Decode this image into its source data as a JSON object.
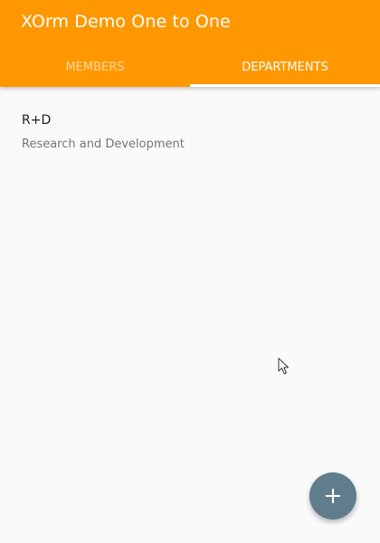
{
  "app_bar": {
    "title": "XOrm Demo One to One",
    "background_color": "#ff9800"
  },
  "tabs": [
    {
      "label": "MEMBERS",
      "active": false
    },
    {
      "label": "DEPARTMENTS",
      "active": true
    }
  ],
  "departments": [
    {
      "name": "R+D",
      "description": "Research and Development"
    }
  ],
  "fab": {
    "icon": "plus-icon",
    "color": "#607d8b"
  }
}
